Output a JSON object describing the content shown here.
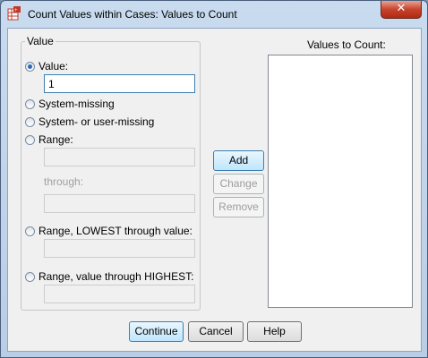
{
  "window": {
    "title": "Count Values within Cases: Values to Count",
    "close_glyph": "✕"
  },
  "value_group": {
    "legend": "Value",
    "options": [
      {
        "label": "Value:",
        "checked": true
      },
      {
        "label": "System-missing",
        "checked": false
      },
      {
        "label": "System- or user-missing",
        "checked": false
      },
      {
        "label": "Range:",
        "checked": false
      },
      {
        "label": "Range, LOWEST through value:",
        "checked": false
      },
      {
        "label": "Range, value through HIGHEST:",
        "checked": false
      }
    ],
    "value_input": "1",
    "through_label": "through:"
  },
  "list": {
    "label": "Values to Count:",
    "items": []
  },
  "buttons": {
    "add": "Add",
    "change": "Change",
    "remove": "Remove",
    "continue": "Continue",
    "cancel": "Cancel",
    "help": "Help"
  },
  "colors": {
    "accent": "#3c7fb1",
    "close": "#c8432c"
  }
}
